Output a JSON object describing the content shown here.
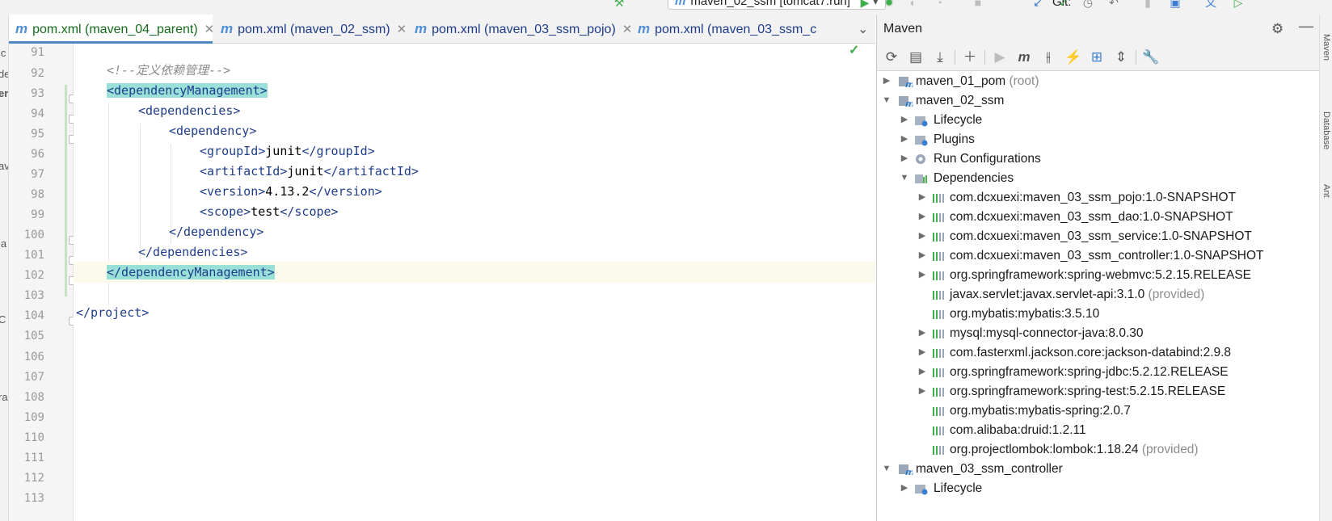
{
  "toolbar": {
    "run_config": "maven_02_ssm [tomcat7:run]",
    "git_label": "Git:"
  },
  "editor": {
    "tabs": [
      {
        "label": "pom.xml (maven_04_parent)",
        "active": true
      },
      {
        "label": "pom.xml (maven_02_ssm)",
        "active": false
      },
      {
        "label": "pom.xml (maven_03_ssm_pojo)",
        "active": false
      },
      {
        "label": "pom.xml (maven_03_ssm_c",
        "active": false
      }
    ],
    "line_numbers": [
      "91",
      "92",
      "93",
      "94",
      "95",
      "96",
      "97",
      "98",
      "99",
      "100",
      "101",
      "102",
      "103",
      "104",
      "105",
      "106",
      "107",
      "108",
      "109",
      "110",
      "111",
      "112",
      "113"
    ],
    "code": {
      "comment": "<!--定义依赖管理-->",
      "dm_open": "<dependencyManagement>",
      "deps_open": "<dependencies>",
      "dep_open": "<dependency>",
      "groupId_open": "<groupId>",
      "groupId_val": "junit",
      "groupId_close": "</groupId>",
      "artifactId_open": "<artifactId>",
      "artifactId_val": "junit",
      "artifactId_close": "</artifactId>",
      "version_open": "<version>",
      "version_val": "4.13.2",
      "version_close": "</version>",
      "scope_open": "<scope>",
      "scope_val": "test",
      "scope_close": "</scope>",
      "dep_close": "</dependency>",
      "deps_close": "</dependencies>",
      "dm_close": "</dependencyManagement>",
      "project_close": "</project>"
    }
  },
  "maven": {
    "title": "Maven",
    "tree": {
      "root_pom": {
        "label": "maven_01_pom",
        "suffix": "(root)"
      },
      "ssm": {
        "label": "maven_02_ssm",
        "lifecycle": "Lifecycle",
        "plugins": "Plugins",
        "run_configurations": "Run Configurations",
        "dependencies": "Dependencies"
      },
      "deps": [
        {
          "label": "com.dcxuexi:maven_03_ssm_pojo:1.0-SNAPSHOT",
          "suffix": ""
        },
        {
          "label": "com.dcxuexi:maven_03_ssm_dao:1.0-SNAPSHOT",
          "suffix": ""
        },
        {
          "label": "com.dcxuexi:maven_03_ssm_service:1.0-SNAPSHOT",
          "suffix": ""
        },
        {
          "label": "com.dcxuexi:maven_03_ssm_controller:1.0-SNAPSHOT",
          "suffix": ""
        },
        {
          "label": "org.springframework:spring-webmvc:5.2.15.RELEASE",
          "suffix": ""
        },
        {
          "label": "javax.servlet:javax.servlet-api:3.1.0",
          "suffix": "(provided)"
        },
        {
          "label": "org.mybatis:mybatis:3.5.10",
          "suffix": ""
        },
        {
          "label": "mysql:mysql-connector-java:8.0.30",
          "suffix": ""
        },
        {
          "label": "com.fasterxml.jackson.core:jackson-databind:2.9.8",
          "suffix": ""
        },
        {
          "label": "org.springframework:spring-jdbc:5.2.12.RELEASE",
          "suffix": ""
        },
        {
          "label": "org.springframework:spring-test:5.2.15.RELEASE",
          "suffix": ""
        },
        {
          "label": "org.mybatis:mybatis-spring:2.0.7",
          "suffix": ""
        },
        {
          "label": "com.alibaba:druid:1.2.11",
          "suffix": ""
        },
        {
          "label": "org.projectlombok:lombok:1.18.24",
          "suffix": "(provided)"
        }
      ],
      "controller": {
        "label": "maven_03_ssm_controller",
        "lifecycle": "Lifecycle"
      }
    }
  }
}
